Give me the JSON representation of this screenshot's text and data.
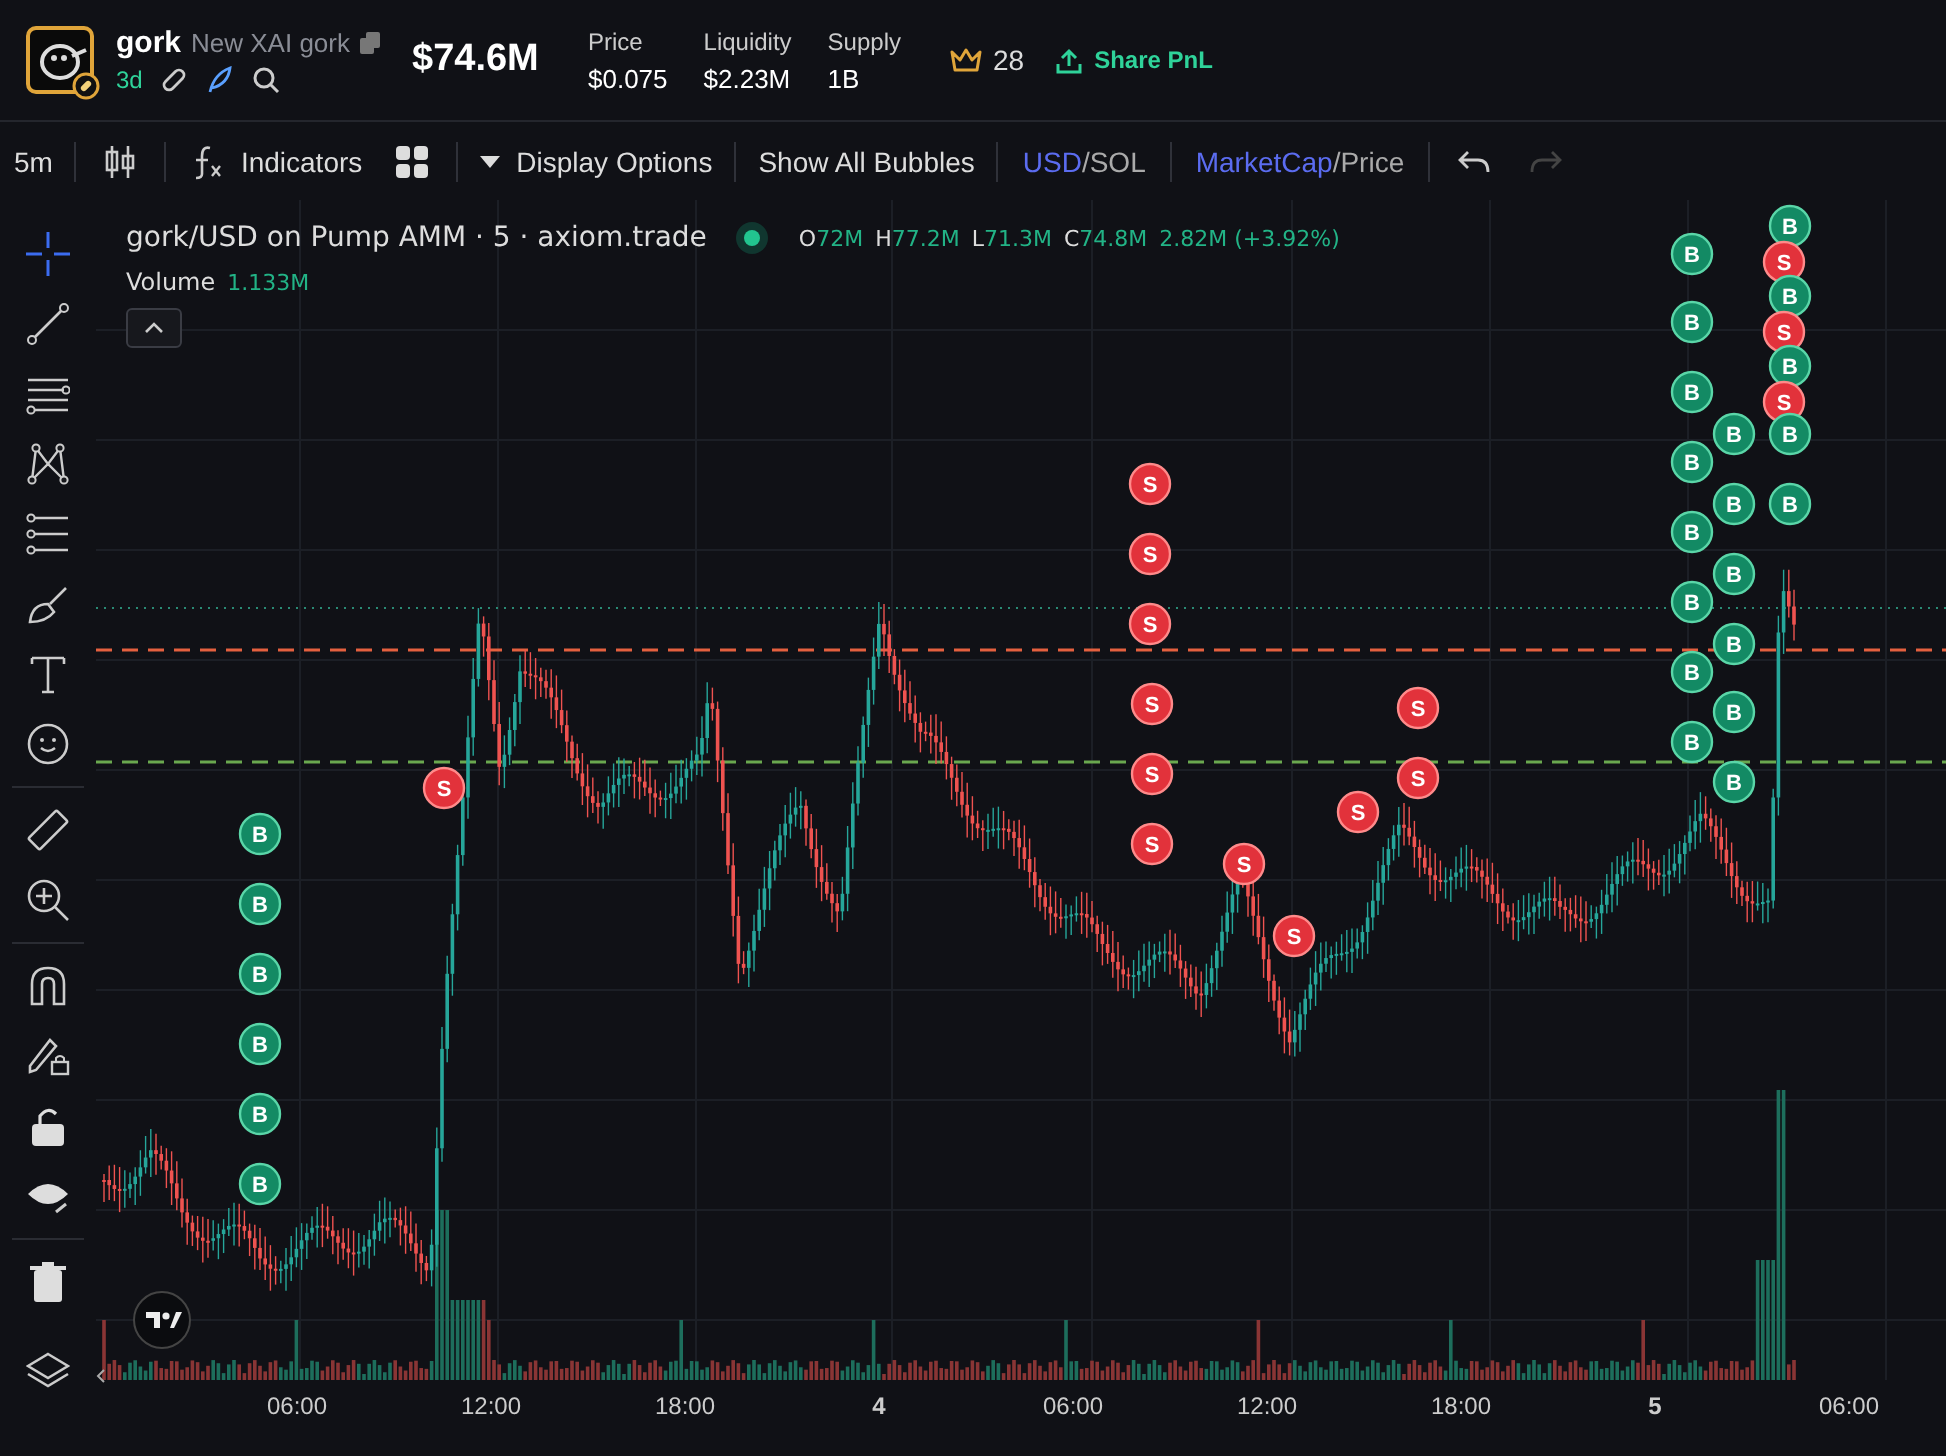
{
  "header": {
    "token": {
      "symbol": "gork",
      "name": "New XAI gork",
      "age": "3d"
    },
    "market_cap": "$74.6M",
    "stats": [
      {
        "label": "Price",
        "value": "$0.075"
      },
      {
        "label": "Liquidity",
        "value": "$2.23M"
      },
      {
        "label": "Supply",
        "value": "1B"
      }
    ],
    "holders": "28",
    "share_button": "Share PnL"
  },
  "toolbar": {
    "interval": "5m",
    "indicators": "Indicators",
    "display_options": "Display Options",
    "bubbles": "Show All Bubbles",
    "currency": {
      "separator": "/",
      "options": [
        {
          "label": "USD",
          "selected": true
        },
        {
          "label": "SOL",
          "selected": false
        }
      ]
    },
    "metric": {
      "separator": "/",
      "options": [
        {
          "label": "MarketCap",
          "selected": true
        },
        {
          "label": "Price",
          "selected": false
        }
      ]
    },
    "redo_disabled": true
  },
  "chart": {
    "title": "gork/USD on Pump AMM · 5 · axiom.trade",
    "ohlc": [
      {
        "key": "O",
        "value": "72M"
      },
      {
        "key": "H",
        "value": "77.2M"
      },
      {
        "key": "L",
        "value": "71.3M"
      },
      {
        "key": "C",
        "value": "74.8M"
      }
    ],
    "change": "2.82M (+3.92%)",
    "volume_label": "Volume",
    "volume": "1.133M",
    "x_axis": [
      {
        "label": "06:00",
        "bold": false
      },
      {
        "label": "12:00",
        "bold": false
      },
      {
        "label": "18:00",
        "bold": false
      },
      {
        "label": "4",
        "bold": true
      },
      {
        "label": "06:00",
        "bold": false
      },
      {
        "label": "12:00",
        "bold": false
      },
      {
        "label": "18:00",
        "bold": false
      },
      {
        "label": "5",
        "bold": true
      },
      {
        "label": "06:00",
        "bold": false
      }
    ],
    "bubbles": [
      {
        "kind": "buy",
        "label": "B"
      },
      {
        "kind": "buy",
        "label": "B"
      },
      {
        "kind": "buy",
        "label": "B"
      },
      {
        "kind": "buy",
        "label": "B"
      },
      {
        "kind": "buy",
        "label": "B"
      },
      {
        "kind": "buy",
        "label": "B"
      },
      {
        "kind": "sell",
        "label": "S"
      },
      {
        "kind": "sell",
        "label": "S"
      },
      {
        "kind": "sell",
        "label": "S"
      },
      {
        "kind": "sell",
        "label": "S"
      },
      {
        "kind": "sell",
        "label": "S"
      },
      {
        "kind": "sell",
        "label": "S"
      },
      {
        "kind": "sell",
        "label": "S"
      },
      {
        "kind": "sell",
        "label": "S"
      },
      {
        "kind": "sell",
        "label": "S"
      },
      {
        "kind": "sell",
        "label": "S"
      },
      {
        "kind": "sell",
        "label": "S"
      },
      {
        "kind": "sell",
        "label": "S"
      },
      {
        "kind": "buy",
        "label": "B"
      },
      {
        "kind": "buy",
        "label": "B"
      },
      {
        "kind": "buy",
        "label": "B"
      },
      {
        "kind": "buy",
        "label": "B"
      },
      {
        "kind": "buy",
        "label": "B"
      },
      {
        "kind": "buy",
        "label": "B"
      },
      {
        "kind": "buy",
        "label": "B"
      },
      {
        "kind": "buy",
        "label": "B"
      },
      {
        "kind": "buy",
        "label": "B"
      },
      {
        "kind": "buy",
        "label": "B"
      },
      {
        "kind": "buy",
        "label": "B"
      },
      {
        "kind": "buy",
        "label": "B"
      },
      {
        "kind": "buy",
        "label": "B"
      },
      {
        "kind": "buy",
        "label": "B"
      },
      {
        "kind": "buy",
        "label": "B"
      },
      {
        "kind": "sell",
        "label": "S"
      },
      {
        "kind": "buy",
        "label": "B"
      },
      {
        "kind": "sell",
        "label": "S"
      },
      {
        "kind": "buy",
        "label": "B"
      },
      {
        "kind": "sell",
        "label": "S"
      },
      {
        "kind": "buy",
        "label": "B"
      },
      {
        "kind": "buy",
        "label": "B"
      }
    ]
  }
}
